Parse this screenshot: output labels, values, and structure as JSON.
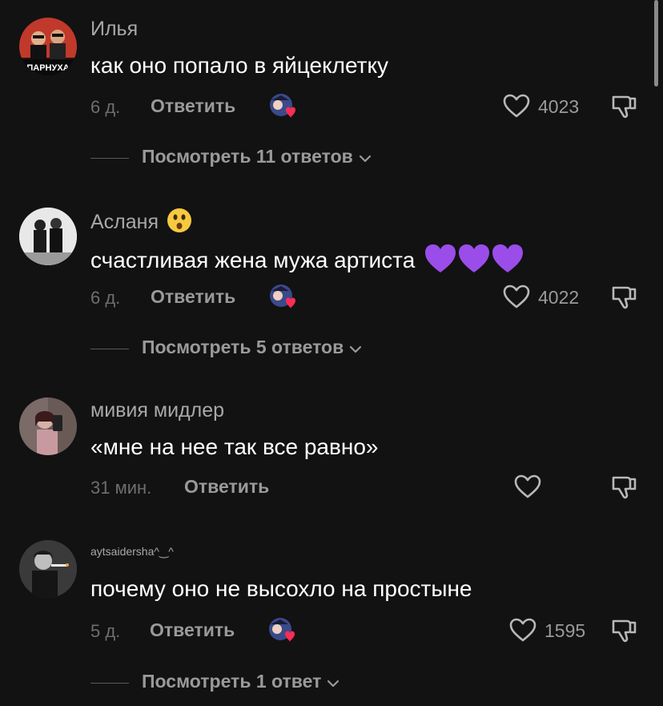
{
  "comments": [
    {
      "author": "Илья",
      "text": "как оно попало в яйцеклетку",
      "time": "6 д.",
      "reply_label": "Ответить",
      "likes": "4023",
      "view_replies": "Посмотреть 11 ответов",
      "avatar_text": "ПАРНУХА"
    },
    {
      "author": "Асланя",
      "text": "счастливая жена мужа артиста",
      "time": "6 д.",
      "reply_label": "Ответить",
      "likes": "4022",
      "view_replies": "Посмотреть 5 ответов",
      "author_emoji": "astonished-face",
      "text_emoji": "purple-heart x3"
    },
    {
      "author": "мивия мидлер",
      "text": "«мне на нее так все равно»",
      "time": "31 мин.",
      "reply_label": "Ответить"
    },
    {
      "author": "aytsaidersha^‿^",
      "text": "почему оно не высохло на простыне",
      "time": "5 д.",
      "reply_label": "Ответить",
      "likes": "1595",
      "view_replies": "Посмотреть 1 ответ"
    }
  ],
  "colors": {
    "background": "#121212",
    "secondary_text": "#a8a8a8",
    "muted_text": "#6e6e6e",
    "heart_red": "#fe2c55",
    "purple_heart": "#9b4dea"
  },
  "icons": [
    "heart-icon",
    "dislike-icon",
    "chevron-down-icon",
    "creator-liked-badge",
    "purple-heart-icon",
    "astonished-face-emoji"
  ]
}
